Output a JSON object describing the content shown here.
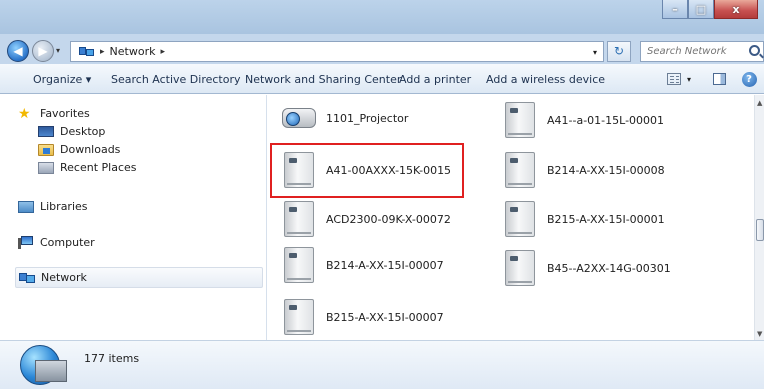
{
  "window": {
    "minimize": "–",
    "maximize": "□",
    "close": "x"
  },
  "address": {
    "crumbs": [
      "Network"
    ],
    "separator": "▸",
    "refresh": "↻"
  },
  "search": {
    "placeholder": "Search Network"
  },
  "toolbar": {
    "organize": "Organize ▾",
    "search_ad": "Search Active Directory",
    "network_sharing": "Network and Sharing Center",
    "add_printer": "Add a printer",
    "add_wireless": "Add a wireless device",
    "help": "?"
  },
  "nav": {
    "favorites": "Favorites",
    "desktop": "Desktop",
    "downloads": "Downloads",
    "recent": "Recent Places",
    "libraries": "Libraries",
    "computer": "Computer",
    "network": "Network"
  },
  "items": [
    {
      "name": "1101_Projector",
      "type": "projector"
    },
    {
      "name": "A41--a-01-15L-00001",
      "type": "device"
    },
    {
      "name": "A41-00AXXX-15K-0015",
      "type": "device",
      "highlighted": true
    },
    {
      "name": "B214-A-XX-15I-00008",
      "type": "device"
    },
    {
      "name": "ACD2300-09K-X-00072",
      "type": "device"
    },
    {
      "name": "B215-A-XX-15I-00001",
      "type": "device"
    },
    {
      "name": "B214-A-XX-15I-00007",
      "type": "device"
    },
    {
      "name": "B45--A2XX-14G-00301",
      "type": "device"
    },
    {
      "name": "B215-A-XX-15I-00007",
      "type": "device"
    }
  ],
  "status": {
    "count": "177 items"
  },
  "colors": {
    "highlight": "#e02020",
    "titlebar": "#bcd3ea"
  }
}
